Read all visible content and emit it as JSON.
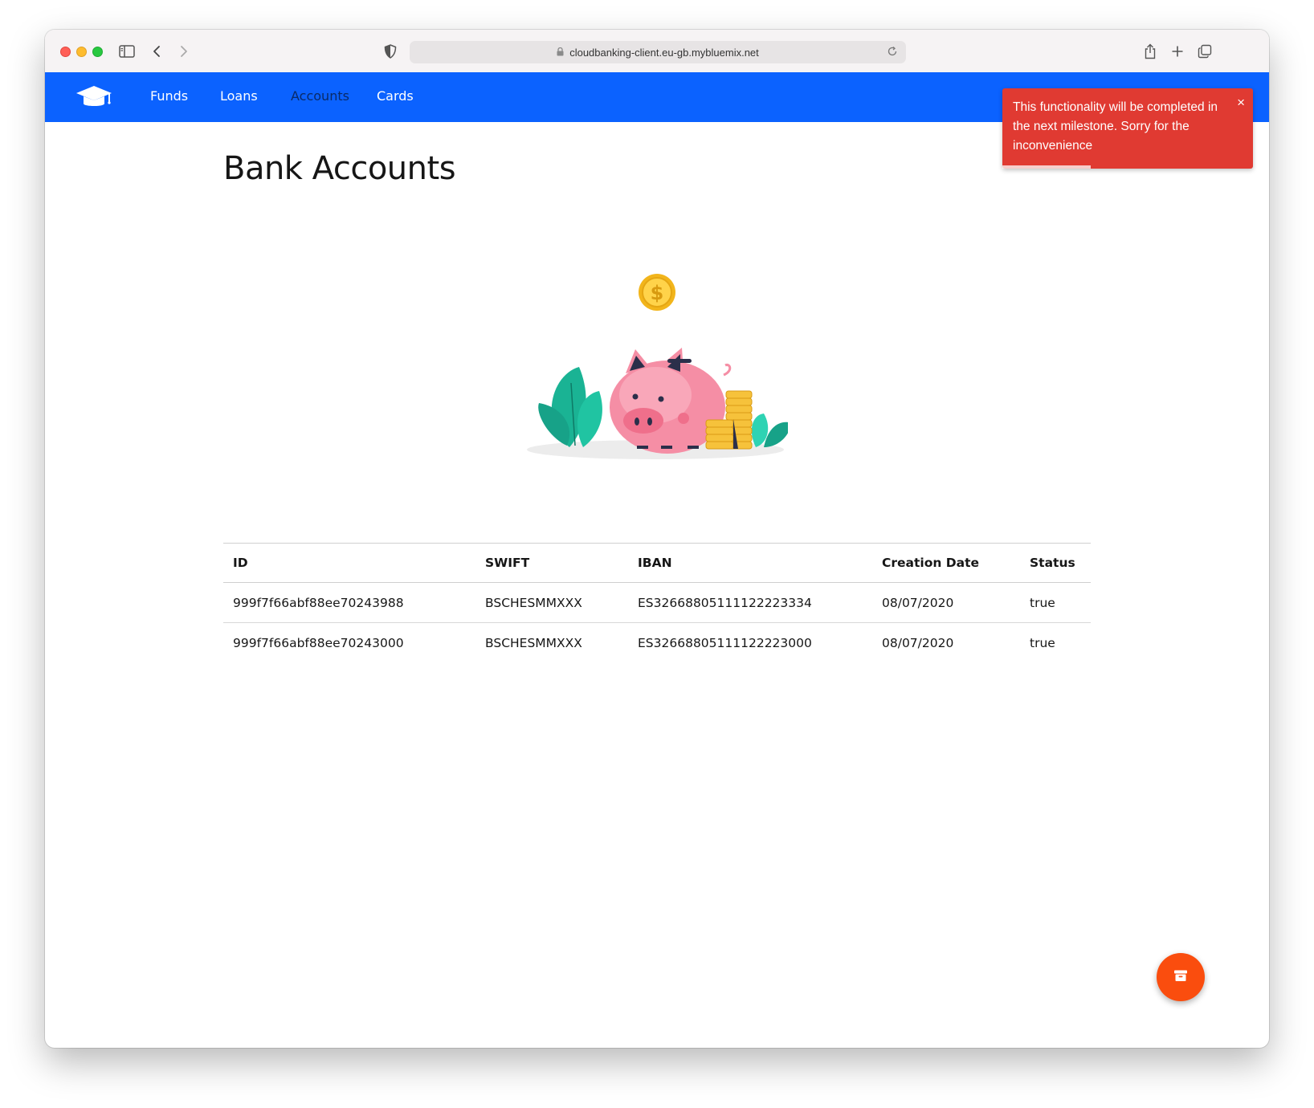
{
  "browser": {
    "url": "cloudbanking-client.eu-gb.mybluemix.net"
  },
  "nav": {
    "items": [
      {
        "label": "Funds"
      },
      {
        "label": "Loans"
      },
      {
        "label": "Accounts"
      },
      {
        "label": "Cards"
      }
    ],
    "active": "Accounts",
    "background": "#0b62ff"
  },
  "toast": {
    "message": "This functionality will be completed in the next milestone. Sorry for the inconvenience",
    "close_glyph": "×",
    "color": "#e03a32"
  },
  "page": {
    "title": "Bank Accounts"
  },
  "table": {
    "headers": [
      "ID",
      "SWIFT",
      "IBAN",
      "Creation Date",
      "Status"
    ],
    "rows": [
      [
        "999f7f66abf88ee70243988",
        "BSCHESMMXXX",
        "ES3266880511112222333 4",
        "08/07/2020",
        "true"
      ],
      [
        "999f7f66abf88ee70243000",
        "BSCHESMMXXX",
        "ES32668805111122223000",
        "08/07/2020",
        "true"
      ]
    ]
  },
  "fab": {
    "icon": "archive-icon",
    "color": "#fa4d0e"
  }
}
